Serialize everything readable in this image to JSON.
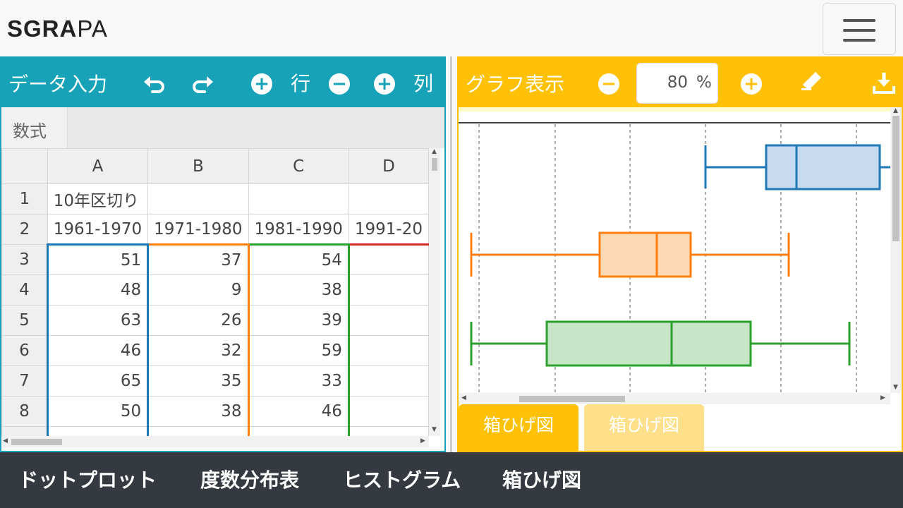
{
  "app": {
    "logo_main": "SGRA",
    "logo_tail": "PA"
  },
  "data_panel": {
    "title": "データ入力",
    "row_label": "行",
    "col_label": "列",
    "formula_label": "数式",
    "columns": [
      "A",
      "B",
      "C",
      "D"
    ],
    "rows": [
      {
        "n": "1",
        "cells": [
          "10年区切り",
          "",
          "",
          ""
        ]
      },
      {
        "n": "2",
        "cells": [
          "1961-1970",
          "1971-1980",
          "1981-1990",
          "1991-20"
        ]
      },
      {
        "n": "3",
        "cells": [
          "51",
          "37",
          "54",
          ""
        ]
      },
      {
        "n": "4",
        "cells": [
          "48",
          "9",
          "38",
          ""
        ]
      },
      {
        "n": "5",
        "cells": [
          "63",
          "26",
          "39",
          ""
        ]
      },
      {
        "n": "6",
        "cells": [
          "46",
          "32",
          "59",
          ""
        ]
      },
      {
        "n": "7",
        "cells": [
          "65",
          "35",
          "33",
          ""
        ]
      },
      {
        "n": "8",
        "cells": [
          "50",
          "38",
          "46",
          ""
        ]
      }
    ]
  },
  "graph_panel": {
    "title": "グラフ表示",
    "zoom_value": "80",
    "zoom_unit": "%",
    "tabs": [
      "箱ひげ図",
      "箱ひげ図"
    ]
  },
  "bottom_nav": [
    "ドットプロット",
    "度数分布表",
    "ヒストグラム",
    "箱ひげ図"
  ],
  "colors": {
    "left_accent": "#17a2b8",
    "right_accent": "#ffc107",
    "series_a": "#1f77b4",
    "series_b": "#ff7f0e",
    "series_c": "#2ca02c",
    "series_d": "#d62728"
  }
}
